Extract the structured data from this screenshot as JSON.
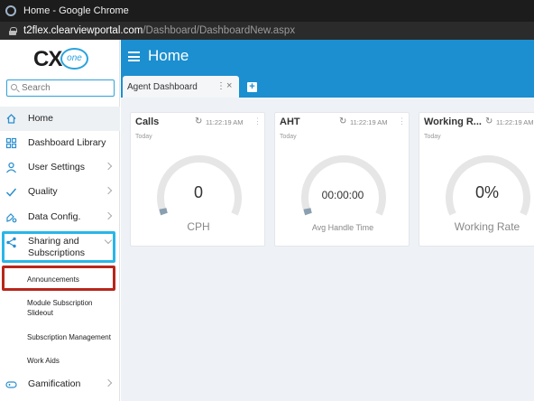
{
  "window": {
    "title": "Home - Google Chrome"
  },
  "address_bar": {
    "domain": "t2flex.clearviewportal.com",
    "path": "/Dashboard/DashboardNew.aspx"
  },
  "logo": {
    "cx": "CX",
    "one": "one"
  },
  "sidebar": {
    "search_placeholder": "Search",
    "items": [
      {
        "label": "Home",
        "icon": "home-icon"
      },
      {
        "label": "Dashboard Library",
        "icon": "grid-icon"
      },
      {
        "label": "User Settings",
        "icon": "user-icon"
      },
      {
        "label": "Quality",
        "icon": "check-icon"
      },
      {
        "label": "Data Config.",
        "icon": "data-config-icon"
      },
      {
        "label": "Sharing and Subscriptions",
        "icon": "share-icon"
      },
      {
        "label": "Gamification",
        "icon": "gamepad-icon"
      }
    ],
    "subitems": [
      "Announcements",
      "Module Subscription Slideout",
      "Subscription Management",
      "Work Aids"
    ]
  },
  "header": {
    "title": "Home"
  },
  "tabs": [
    {
      "label": "Agent Dashboard"
    }
  ],
  "cards": [
    {
      "title": "Calls",
      "time": "11:22:19 AM",
      "period": "Today",
      "value": "0",
      "unit": "CPH",
      "gauge_fill": 0
    },
    {
      "title": "AHT",
      "time": "11:22:19 AM",
      "period": "Today",
      "value": "00:00:00",
      "unit": "Avg Handle Time",
      "gauge_fill": 0
    },
    {
      "title": "Working R...",
      "time": "11:22:19 AM",
      "period": "Today",
      "value": "0%",
      "unit": "Working Rate",
      "gauge_fill": 0
    }
  ],
  "colors": {
    "brand_blue": "#1b8fd0",
    "highlight_blue": "#29b6e8",
    "highlight_red": "#b8261b",
    "gauge_track": "#e6e6e6",
    "gauge_start": "#8a9fb0"
  }
}
